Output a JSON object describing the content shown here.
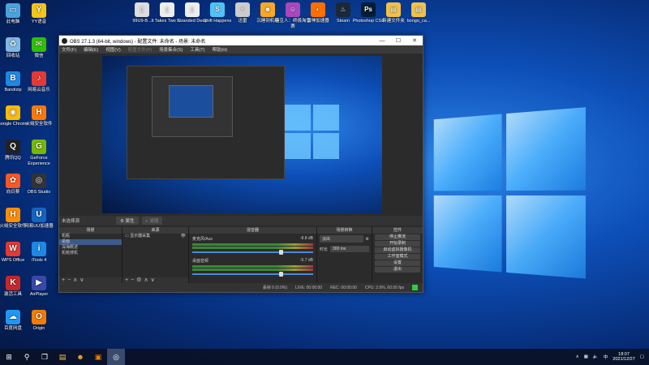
{
  "desktop": {
    "left_icons": [
      {
        "label": "此电脑",
        "icon": "computer-icon",
        "color": "#4aa3df",
        "glyph": "▭"
      },
      {
        "label": "YY语音",
        "icon": "yy-icon",
        "color": "#f5c518",
        "glyph": "Y"
      },
      {
        "label": "回收站",
        "icon": "recycle-bin-icon",
        "color": "#7fb8e0",
        "glyph": "♻"
      },
      {
        "label": "微信",
        "icon": "wechat-icon",
        "color": "#2dc100",
        "glyph": "✉"
      },
      {
        "label": "Bandizip",
        "icon": "bandizip-icon",
        "color": "#1e88e5",
        "glyph": "B"
      },
      {
        "label": "网易云音乐",
        "icon": "netease-music-icon",
        "color": "#e53935",
        "glyph": "♪"
      },
      {
        "label": "Google Chrome",
        "icon": "chrome-icon",
        "color": "#fbbc05",
        "glyph": "◉"
      },
      {
        "label": "火绒安全软件",
        "icon": "huorong-icon",
        "color": "#ff7a00",
        "glyph": "H"
      },
      {
        "label": "腾讯QQ",
        "icon": "qq-icon",
        "color": "#222",
        "glyph": "Q"
      },
      {
        "label": "GeForce Experience",
        "icon": "geforce-icon",
        "color": "#76b900",
        "glyph": "G"
      },
      {
        "label": "向日葵",
        "icon": "sunflower-icon",
        "color": "#ff5722",
        "glyph": "✿"
      },
      {
        "label": "OBS Studio",
        "icon": "obs-icon",
        "color": "#333",
        "glyph": "◎"
      },
      {
        "label": "火绒安全软件",
        "icon": "huorong-shield-icon",
        "color": "#ff8f00",
        "glyph": "H"
      },
      {
        "label": "网易UU加速器",
        "icon": "uu-icon",
        "color": "#1565c0",
        "glyph": "U"
      },
      {
        "label": "WPS Office",
        "icon": "wps-icon",
        "color": "#e53935",
        "glyph": "W"
      },
      {
        "label": "iTools 4",
        "icon": "itools-icon",
        "color": "#1e88e5",
        "glyph": "i"
      },
      {
        "label": "激活工具",
        "icon": "activation-tool-icon",
        "color": "#c62828",
        "glyph": "K"
      },
      {
        "label": "AirPlayer",
        "icon": "airplayer-icon",
        "color": "#3949ab",
        "glyph": "▶"
      },
      {
        "label": "百度网盘",
        "icon": "baidu-netdisk-icon",
        "color": "#2196f3",
        "glyph": "☁"
      },
      {
        "label": "Origin",
        "icon": "origin-icon",
        "color": "#f57c00",
        "glyph": "O"
      }
    ],
    "top_icons": [
      {
        "label": "99U9-B...",
        "icon": "file-icon",
        "color": "#ddd",
        "glyph": "▯"
      },
      {
        "label": "It Takes Two F...",
        "icon": "ittakestwo-icon",
        "color": "#eee",
        "glyph": "▯"
      },
      {
        "label": "Stranded Deep",
        "icon": "stranded-deep-icon",
        "color": "#eee",
        "glyph": "▯"
      },
      {
        "label": "Shift Happens",
        "icon": "shift-happens-icon",
        "color": "#4fc3f7",
        "glyph": "S"
      },
      {
        "label": "迅雷",
        "icon": "thunder-icon",
        "color": "#ccc",
        "glyph": "⚡"
      },
      {
        "label": "沉睡到机组",
        "icon": "game-icon",
        "color": "#f9a825",
        "glyph": "☻"
      },
      {
        "label": "糖豆人：终极淘汰赛",
        "icon": "fall-guys-icon",
        "color": "#ab47bc",
        "glyph": "☺"
      },
      {
        "label": "雷神加速器",
        "icon": "leishen-icon",
        "color": "#ff6f00",
        "glyph": "◐"
      },
      {
        "label": "Steam",
        "icon": "steam-icon",
        "color": "#1b2838",
        "glyph": "♨"
      },
      {
        "label": "Photoshop CS6",
        "icon": "photoshop-icon",
        "color": "#001d34",
        "glyph": "Ps"
      },
      {
        "label": "新建文件夹",
        "icon": "folder-icon",
        "color": "#f0c24b",
        "glyph": "▤"
      },
      {
        "label": "bongo_ca...",
        "icon": "folder-icon",
        "color": "#f0c24b",
        "glyph": "▤"
      }
    ]
  },
  "obs": {
    "title": "OBS 27.1.3 (64-bit, windows) - 配置文件: 未命名 - 场景: 未命名",
    "menu": [
      "文件(F)",
      "编辑(E)",
      "视图(V)",
      "配置文件(P)",
      "场景集合(S)",
      "工具(T)",
      "帮助(H)"
    ],
    "no_source": "未选择源",
    "props_label": "属性",
    "filter_label": "滤镜",
    "scenes_header": "场景",
    "scenes": [
      "机瓶",
      "桌面",
      "深海概述",
      "机枪搜机"
    ],
    "sources_header": "来源",
    "sources": [
      "显示器采集"
    ],
    "mixer_header": "混音器",
    "mixer": [
      {
        "name": "麦克风/Aux",
        "db": "-8.8 dB"
      },
      {
        "name": "桌面音频",
        "db": "-5.7 dB"
      }
    ],
    "transitions_header": "场景转换",
    "transition": "淡出",
    "duration_label": "时长",
    "duration": "300 ms",
    "controls_header": "控件",
    "controls": [
      "停止推流",
      "开始录制",
      "启动虚拟摄像机",
      "工作室模式",
      "设置",
      "退出"
    ],
    "status": {
      "dropped": "丢帧 0 (0.0%)",
      "live": "LIVE: 00:00:00",
      "rec": "REC: 00:00:00",
      "cpu": "CPU: 2.9%, 60.00 fps"
    }
  },
  "taskbar": {
    "time": "18:07",
    "date": "2021/12/27",
    "lang": "中"
  }
}
